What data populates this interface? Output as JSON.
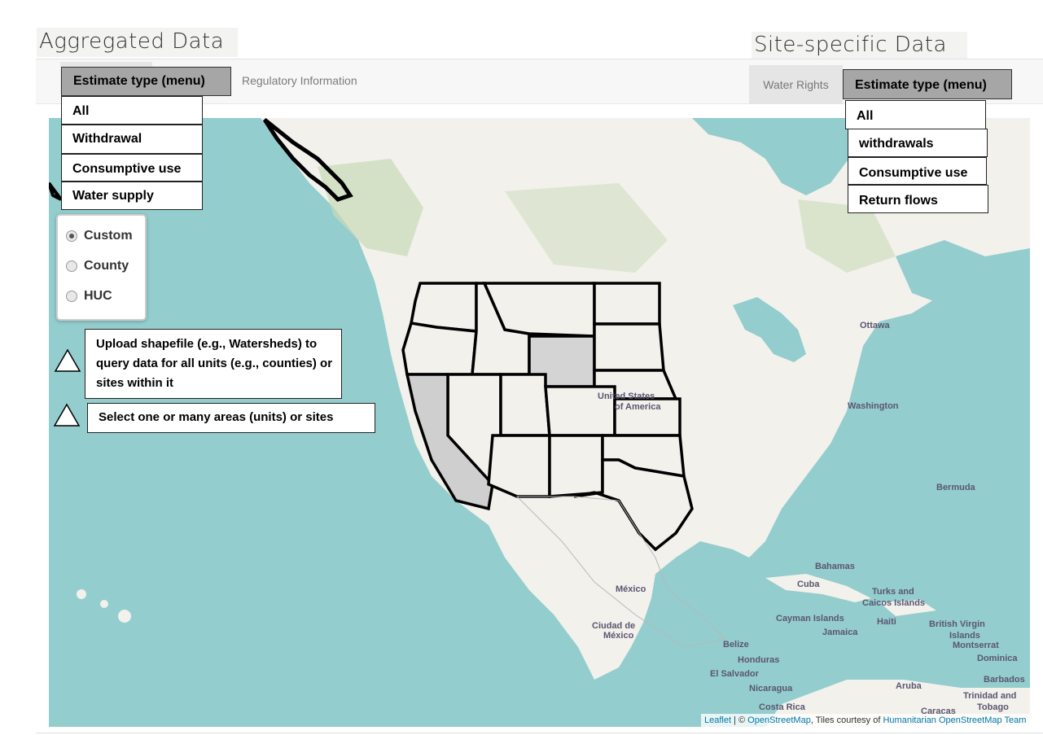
{
  "headings": {
    "aggregated": "Aggregated Data",
    "site_specific": "Site-specific Data"
  },
  "toolbar": {
    "regulatory_tab": "Regulatory Information",
    "water_rights_tab": "Water Rights"
  },
  "aggregated_menu": {
    "label": "Estimate type (menu)",
    "items": [
      "All",
      "Withdrawal",
      "Consumptive use",
      "Water supply"
    ]
  },
  "site_menu": {
    "label": "Estimate type (menu)",
    "items": [
      "All",
      "withdrawals",
      "Consumptive use",
      "Return flows"
    ]
  },
  "area_mode": {
    "options": [
      "Custom",
      "County",
      "HUC"
    ],
    "selected": "Custom"
  },
  "notes": {
    "upload": "Upload shapefile (e.g., Watersheds) to query data for all units (e.g., counties) or sites within it",
    "select": "Select one or many areas (units) or sites"
  },
  "map": {
    "labels": {
      "ottawa": "Ottawa",
      "usa_line1": "United States",
      "usa_line2": "of America",
      "washington": "Washington",
      "bermuda": "Bermuda",
      "bahamas": "Bahamas",
      "cuba": "Cuba",
      "turks_line1": "Turks and",
      "turks_line2": "Caicos Islands",
      "cayman": "Cayman Islands",
      "haiti": "Haiti",
      "bvi_line1": "British Virgin",
      "bvi_line2": "Islands",
      "montserrat": "Montserrat",
      "dominica": "Dominica",
      "jamaica": "Jamaica",
      "mexico": "México",
      "cdmx_line1": "Ciudad de",
      "cdmx_line2": "México",
      "belize": "Belize",
      "honduras": "Honduras",
      "el_salvador": "El Salvador",
      "nicaragua": "Nicaragua",
      "costa_rica": "Costa Rica",
      "aruba": "Aruba",
      "caracas": "Caracas",
      "barbados": "Barbados",
      "trinidad_line1": "Trinidad and",
      "trinidad_line2": "Tobago"
    },
    "attribution": {
      "leaflet": "Leaflet",
      "sep": " | © ",
      "osm": "OpenStreetMap",
      "tiles": ", Tiles courtesy of ",
      "hot": "Humanitarian OpenStreetMap Team"
    },
    "colors": {
      "water": "#93cdcd",
      "land": "#f2f1ec",
      "forest": "#c9dab8",
      "state_border": "#000000",
      "selected_fill": "#d4d4d4"
    }
  }
}
